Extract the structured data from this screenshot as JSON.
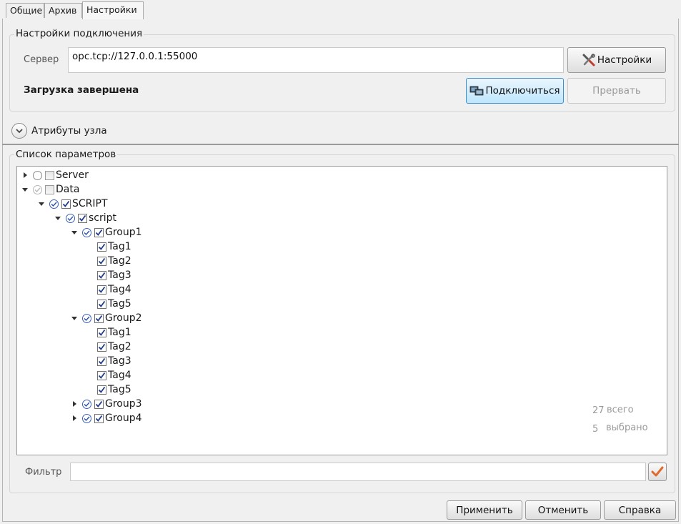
{
  "tabs": [
    "Общие",
    "Архив",
    "Настройки"
  ],
  "connection": {
    "group_title": "Настройки подключения",
    "server_label": "Сервер",
    "server_value": "opc.tcp://127.0.0.1:55000",
    "settings_button": "Настройки",
    "status": "Загрузка завершена",
    "connect_button": "Подключиться",
    "abort_button": "Прервать"
  },
  "node_attributes": {
    "label": "Атрибуты узла"
  },
  "params": {
    "group_title": "Список параметров",
    "tree": [
      {
        "label": "Server",
        "level": 0,
        "expander": "collapsed",
        "checked": false,
        "status": "empty"
      },
      {
        "label": "Data",
        "level": 0,
        "expander": "expanded",
        "checked": false,
        "status": "light"
      },
      {
        "label": "SCRIPT",
        "level": 1,
        "expander": "expanded",
        "checked": true,
        "status": "ok"
      },
      {
        "label": "script",
        "level": 2,
        "expander": "expanded",
        "checked": true,
        "status": "ok"
      },
      {
        "label": "Group1",
        "level": 3,
        "expander": "expanded",
        "checked": true,
        "status": "ok"
      },
      {
        "label": "Tag1",
        "level": 4,
        "expander": "none",
        "checked": true,
        "status": "none"
      },
      {
        "label": "Tag2",
        "level": 4,
        "expander": "none",
        "checked": true,
        "status": "none"
      },
      {
        "label": "Tag3",
        "level": 4,
        "expander": "none",
        "checked": true,
        "status": "none"
      },
      {
        "label": "Tag4",
        "level": 4,
        "expander": "none",
        "checked": true,
        "status": "none"
      },
      {
        "label": "Tag5",
        "level": 4,
        "expander": "none",
        "checked": true,
        "status": "none"
      },
      {
        "label": "Group2",
        "level": 3,
        "expander": "expanded",
        "checked": true,
        "status": "ok"
      },
      {
        "label": "Tag1",
        "level": 4,
        "expander": "none",
        "checked": true,
        "status": "none"
      },
      {
        "label": "Tag2",
        "level": 4,
        "expander": "none",
        "checked": true,
        "status": "none"
      },
      {
        "label": "Tag3",
        "level": 4,
        "expander": "none",
        "checked": true,
        "status": "none"
      },
      {
        "label": "Tag4",
        "level": 4,
        "expander": "none",
        "checked": true,
        "status": "none"
      },
      {
        "label": "Tag5",
        "level": 4,
        "expander": "none",
        "checked": true,
        "status": "none"
      },
      {
        "label": "Group3",
        "level": 3,
        "expander": "collapsed",
        "checked": true,
        "status": "ok"
      },
      {
        "label": "Group4",
        "level": 3,
        "expander": "collapsed",
        "checked": true,
        "status": "ok"
      }
    ],
    "total_count": "27",
    "total_label": "всего",
    "selected_count": "5",
    "selected_label": "выбрано",
    "filter_label": "Фильтр",
    "filter_value": ""
  },
  "footer": {
    "apply": "Применить",
    "cancel": "Отменить",
    "help": "Справка"
  },
  "colors": {
    "check_blue": "#1e3a8a",
    "status_ok": "#2a4fa8",
    "filter_check": "#e06a2b"
  }
}
